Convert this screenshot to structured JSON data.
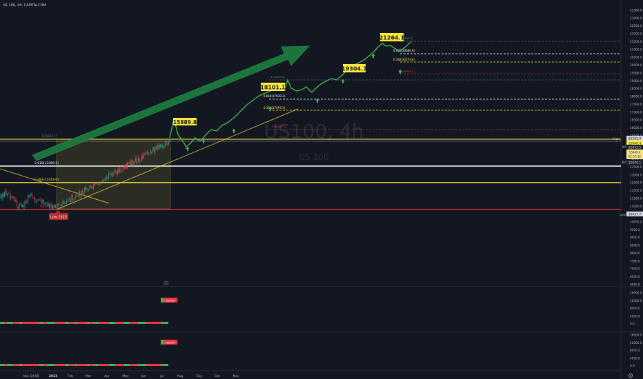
{
  "header": {
    "symbol_line": "US 100, 4h, CAPITALCOM"
  },
  "watermark": {
    "symbol": "US100, 4h",
    "description": "US 100"
  },
  "price_axis": {
    "ticks": [
      "23500.0",
      "23000.0",
      "22500.0",
      "22000.0",
      "21500.0",
      "21000.0",
      "20500.0",
      "20000.0",
      "19500.0",
      "19000.0",
      "18500.0",
      "18000.0",
      "17500.0",
      "17000.0",
      "16500.0",
      "16000.0",
      "15500.0",
      "15000.0",
      "14500.0",
      "14000.0",
      "13500.0",
      "13000.0",
      "12500.0",
      "12000.0",
      "11500.0",
      "11000.0",
      "10500.0",
      "10000.0",
      "9500.0",
      "9000.0",
      "8500.0",
      "8000.0",
      "7500.0",
      "7000.0",
      "6500.0",
      "6000.0"
    ],
    "high_label": "High",
    "high_value": "15282.9",
    "current_value": "15040.4",
    "countdown": "01:53:12",
    "ma_label": "MA",
    "ma_value": "15042.5",
    "bid_label": "Bid",
    "bid_value": "15040.1",
    "low_label": "Low",
    "low_value": "10437.7"
  },
  "time_axis": {
    "labels": [
      "Nov",
      "14:00",
      "2023",
      "Feb",
      "Mar",
      "Apr",
      "May",
      "Jun",
      "Jul",
      "Aug",
      "Sep",
      "Oct",
      "Nov"
    ]
  },
  "fib_levels": [
    {
      "label": "1(15222.4)",
      "color": "#787b86"
    },
    {
      "label": "0.618(13489.5)",
      "color": "#ffffff"
    },
    {
      "label": "0.382(12419.0)",
      "color": "#ffeb3b"
    },
    {
      "label": "0(10656.5)",
      "color": "#f23645"
    }
  ],
  "projection_labels": [
    {
      "label": "1(19045.0)",
      "color": "#787b86"
    },
    {
      "label": "0.618(17839.3)",
      "color": "#ffffff"
    },
    {
      "label": "0.382(17097.3)",
      "color": "#ffeb3b"
    },
    {
      "label": "0(16017.0)",
      "color": "#f23645"
    },
    {
      "label": "1(21892.3)",
      "color": "#787b86"
    },
    {
      "label": "0.618(20680.9)",
      "color": "#ffffff"
    },
    {
      "label": "0.382(20179.6)",
      "color": "#ffeb3b"
    },
    {
      "label": "0(19303.2)",
      "color": "#f23645"
    }
  ],
  "targets": [
    "15889.8",
    "18101.1",
    "19304.7",
    "21264.1"
  ],
  "low_badge": "Low 2023",
  "indicator_panes": [
    {
      "ticks": [
        "16000.0",
        "12000.0",
        "8000.0",
        "4000.0",
        "0.0"
      ],
      "badge": "Bearish"
    },
    {
      "ticks": [
        "16000.0",
        "12000.0",
        "8000.0",
        "4000.0",
        "0.0"
      ],
      "badge": "Bearish"
    }
  ],
  "icons": [
    "settings-icon",
    "collapse-icon"
  ],
  "colors": {
    "background": "#131722",
    "bull": "#22ab94",
    "bear": "#f23645",
    "projection": "#4caf50",
    "accent_yellow": "#ffeb3b"
  }
}
